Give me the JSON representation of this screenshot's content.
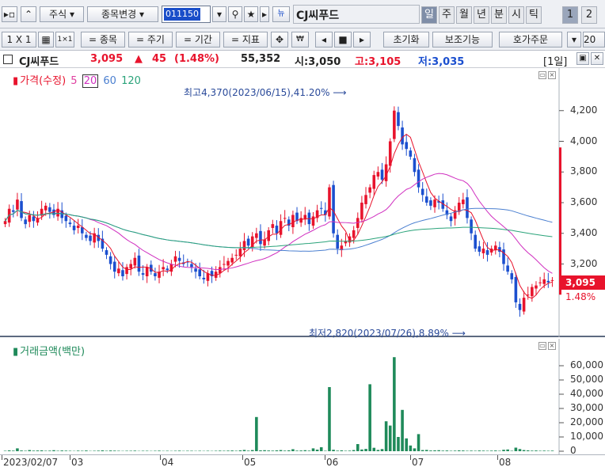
{
  "toolbar1": {
    "market": "주식",
    "change_stock": "종목변경",
    "code": "011150",
    "stock_name": "CJ씨푸드",
    "tabs": [
      "일",
      "주",
      "월",
      "년",
      "분",
      "시",
      "틱"
    ],
    "num_tabs": [
      "1",
      "2"
    ]
  },
  "toolbar2": {
    "ratio": "1 X 1",
    "items_btn": "= 종목",
    "period_btn": "= 주기",
    "range_btn": "= 기간",
    "indicator_btn": "= 지표",
    "reset_btn": "초기화",
    "aux_btn": "보조기능",
    "order_btn": "호가주문",
    "count": "20"
  },
  "info": {
    "name": "CJ씨푸드",
    "price": "3,095",
    "change_arrow": "▲",
    "change": "45",
    "change_pct": "(1.48%)",
    "volume": "55,352",
    "open": "시:3,050",
    "high": "고:3,105",
    "low": "저:3,035",
    "period": "[1일]"
  },
  "price_panel": {
    "legend_title": "가격(수정)",
    "ma_labels": [
      "5",
      "20",
      "60",
      "120"
    ],
    "ma_colors": [
      "#e040a0",
      "#d030c0",
      "#4a7fd0",
      "#2aa37a"
    ],
    "y_ticks": [
      "4,200",
      "4,000",
      "3,800",
      "3,600",
      "3,400",
      "3,200"
    ],
    "current_price": "3,095",
    "current_pct": "1.48%",
    "high_annotation": "최고4,370(2023/06/15),41.20%",
    "low_annotation": "최저2,820(2023/07/26),8.89%"
  },
  "volume_panel": {
    "legend_title": "거래금액(백만)",
    "y_ticks": [
      "60,000",
      "50,000",
      "40,000",
      "30,000",
      "20,000",
      "10,000",
      "0"
    ]
  },
  "x_axis": {
    "labels": [
      "2023/02/07",
      "03",
      "04",
      "05",
      "06",
      "07",
      "08"
    ]
  },
  "colors": {
    "up": "#e8132c",
    "down": "#1b4fcf",
    "volume": "#1f8a5a",
    "accent": "#1a4ec9"
  },
  "chart_data": {
    "type": "candlestick",
    "ylim": [
      2800,
      4400
    ],
    "closes": [
      3480,
      3560,
      3540,
      3620,
      3500,
      3460,
      3520,
      3480,
      3500,
      3560,
      3580,
      3540,
      3520,
      3560,
      3500,
      3480,
      3460,
      3420,
      3450,
      3400,
      3370,
      3350,
      3400,
      3350,
      3300,
      3260,
      3200,
      3150,
      3170,
      3120,
      3180,
      3200,
      3240,
      3150,
      3130,
      3180,
      3150,
      3120,
      3150,
      3180,
      3160,
      3200,
      3250,
      3220,
      3200,
      3210,
      3180,
      3150,
      3120,
      3100,
      3140,
      3120,
      3150,
      3180,
      3200,
      3220,
      3240,
      3260,
      3300,
      3350,
      3320,
      3380,
      3400,
      3330,
      3360,
      3420,
      3460,
      3400,
      3480,
      3500,
      3450,
      3520,
      3480,
      3500,
      3520,
      3460,
      3510,
      3550,
      3560,
      3520,
      3700,
      3400,
      3300,
      3320,
      3350,
      3380,
      3420,
      3500,
      3600,
      3650,
      3700,
      3780,
      3800,
      3750,
      3850,
      4000,
      4200,
      4100,
      3980,
      3950,
      3900,
      3800,
      3700,
      3650,
      3600,
      3580,
      3620,
      3600,
      3560,
      3520,
      3480,
      3550,
      3600,
      3620,
      3500,
      3400,
      3300,
      3280,
      3300,
      3260,
      3300,
      3320,
      3280,
      3200,
      3150,
      3100,
      2950,
      2900,
      2980,
      3000,
      3050,
      3060,
      3080,
      3100,
      3080,
      3095
    ],
    "highs_marked": {
      "value": 4370,
      "date": "2023/06/15"
    },
    "lows_marked": {
      "value": 2820,
      "date": "2023/07/26"
    },
    "volume": [
      300,
      600,
      400,
      2000,
      500,
      300,
      800,
      400,
      500,
      600,
      300,
      400,
      700,
      300,
      500,
      400,
      300,
      200,
      400,
      300,
      500,
      200,
      300,
      400,
      600,
      300,
      500,
      400,
      300,
      200,
      300,
      300,
      400,
      200,
      300,
      300,
      200,
      300,
      400,
      200,
      300,
      200,
      300,
      400,
      200,
      300,
      300,
      200,
      300,
      200,
      300,
      200,
      300,
      400,
      300,
      400,
      500,
      300,
      600,
      900,
      400,
      800,
      24000,
      600,
      700,
      500,
      400,
      600,
      800,
      400,
      600,
      1400,
      400,
      500,
      700,
      400,
      2000,
      1100,
      2800,
      300,
      45000,
      1000,
      400,
      600,
      300,
      400,
      800,
      5000,
      1200,
      1600,
      47000,
      2400,
      900,
      1500,
      21000,
      18000,
      66000,
      10000,
      29000,
      9000,
      4000,
      2000,
      12000,
      800,
      900,
      500,
      600,
      700,
      400,
      500,
      300,
      400,
      600,
      500,
      300,
      400,
      300,
      500,
      400,
      300,
      400,
      500,
      300,
      1000,
      1200,
      300,
      2500,
      1500,
      800,
      600,
      400,
      500,
      300,
      400,
      300,
      400
    ]
  }
}
